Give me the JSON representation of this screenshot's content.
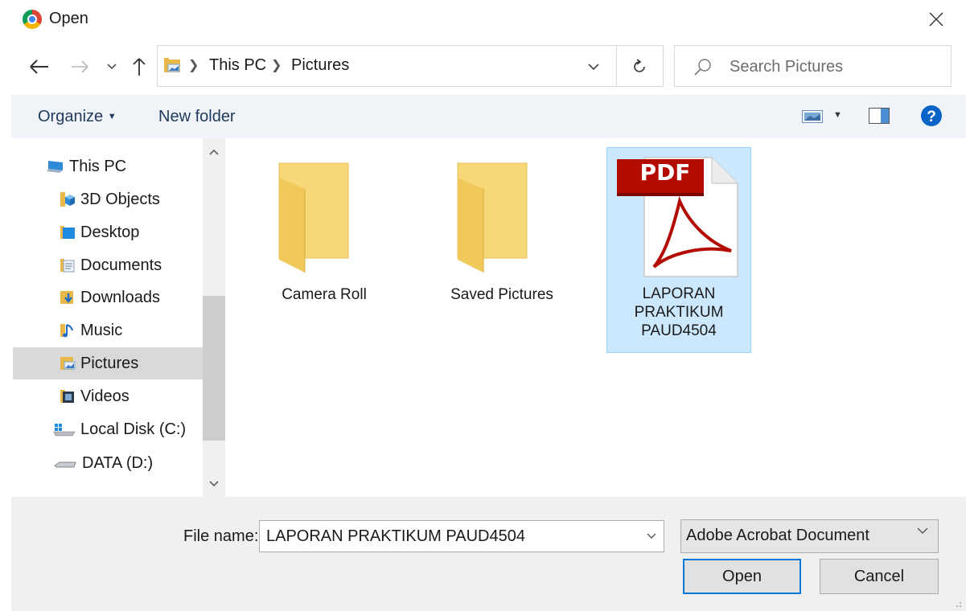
{
  "window": {
    "title": "Open",
    "app_icon": "chrome-icon",
    "close_icon": "close-icon"
  },
  "navigation": {
    "back_icon": "arrow-left-icon",
    "forward_icon": "arrow-right-icon",
    "recent_icon": "chevron-down-icon",
    "up_icon": "arrow-up-icon"
  },
  "address": {
    "path": [
      "This PC",
      "Pictures"
    ],
    "refresh_icon": "refresh-icon"
  },
  "search": {
    "placeholder": "Search Pictures"
  },
  "toolbar": {
    "organize_label": "Organize",
    "new_folder_label": "New folder"
  },
  "sidebar": {
    "items": [
      {
        "label": "This PC",
        "icon": "computer-icon"
      },
      {
        "label": "3D Objects",
        "icon": "3d-objects-folder-icon"
      },
      {
        "label": "Desktop",
        "icon": "desktop-folder-icon"
      },
      {
        "label": "Documents",
        "icon": "documents-folder-icon"
      },
      {
        "label": "Downloads",
        "icon": "downloads-folder-icon"
      },
      {
        "label": "Music",
        "icon": "music-folder-icon"
      },
      {
        "label": "Pictures",
        "icon": "pictures-folder-icon",
        "selected": true
      },
      {
        "label": "Videos",
        "icon": "videos-folder-icon"
      },
      {
        "label": "Local Disk (C:)",
        "icon": "local-disk-icon"
      },
      {
        "label": "DATA (D:)",
        "icon": "drive-icon"
      }
    ]
  },
  "files": [
    {
      "name": "Camera Roll",
      "type": "folder"
    },
    {
      "name": "Saved Pictures",
      "type": "folder"
    },
    {
      "name_lines": [
        "LAPORAN",
        "PRAKTIKUM",
        "PAUD4504"
      ],
      "type": "pdf",
      "badge": "PDF",
      "selected": true
    }
  ],
  "bottom": {
    "file_name_label": "File name:",
    "file_name_value": "LAPORAN PRAKTIKUM PAUD4504",
    "file_type": "Adobe Acrobat Document",
    "open_label": "Open",
    "cancel_label": "Cancel"
  },
  "colors": {
    "selection_bg": "#cce8ff",
    "selection_border": "#99d1ff",
    "primary_button_border": "#0078d7",
    "help_icon": "#0a64c8",
    "pdf_badge": "#b30b00"
  }
}
